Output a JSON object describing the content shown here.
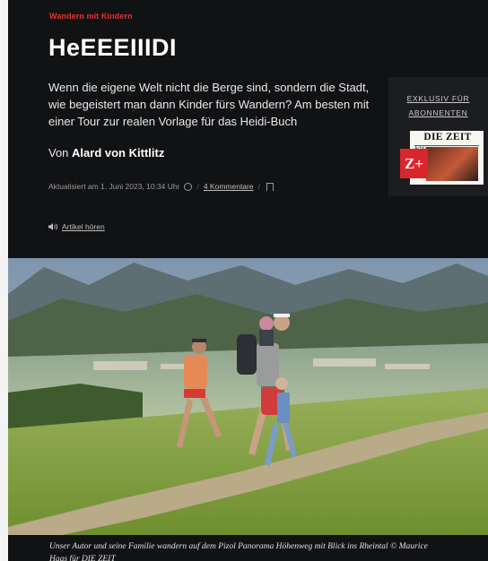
{
  "article": {
    "kicker": "Wandern mit Kindern",
    "title": "HeEEEIIIDI",
    "teaser": "Wenn die eigene Welt nicht die Berge sind, sondern die Stadt, wie begeistert man dann Kinder fürs Wandern? Am besten mit einer Tour zur realen Vorlage für das Heidi-Buch",
    "author_prefix": "Von",
    "author_name": "Alard von Kittlitz",
    "updated": "Aktualisiert am 1. Juni 2023, 10:34 Uhr",
    "comments": "4 Kommentare",
    "listen": "Artikel hören",
    "caption": "Unser Autor und seine Familie wandern auf dem Pizol Panorama Höhenweg mit Blick ins Rheintal © Maurice Haas für DIE ZEIT"
  },
  "promo": {
    "line1": "EXKLUSIV FÜR",
    "line2": "ABONNENTEN",
    "paper_title": "DIE ZEIT",
    "paper_small": "Achtung,",
    "zplus": "Z+"
  },
  "colors": {
    "kicker": "#e3342f",
    "background": "#111214",
    "zplus": "#d9262c"
  },
  "icons": [
    "clock-icon",
    "bookmark-icon",
    "speaker-icon"
  ]
}
